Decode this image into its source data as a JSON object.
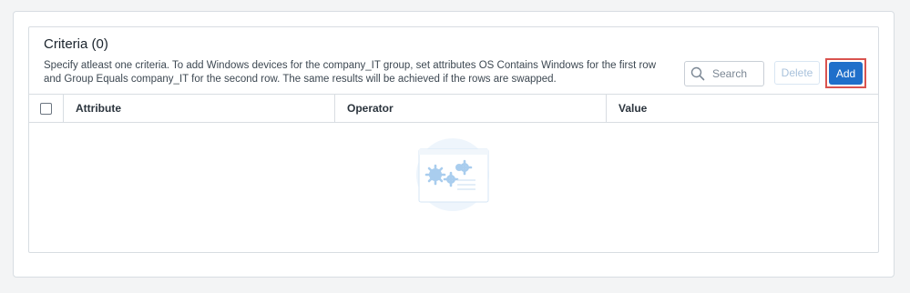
{
  "criteria": {
    "title": "Criteria (0)",
    "description": "Specify atleast one criteria. To add Windows devices for the company_IT group, set attributes OS Contains Windows for the first row and Group Equals company_IT for the second row. The same results will be achieved if the rows are swapped.",
    "search": {
      "placeholder": "Search",
      "icon": "search-icon"
    },
    "buttons": {
      "delete_label": "Delete",
      "add_label": "Add"
    },
    "table": {
      "columns": [
        "Attribute",
        "Operator",
        "Value"
      ],
      "rows": []
    },
    "empty_state_icon": "gears-empty-illustration"
  },
  "colors": {
    "accent": "#1f6fca",
    "highlight": "#d9534f",
    "border": "#d8dde2"
  }
}
